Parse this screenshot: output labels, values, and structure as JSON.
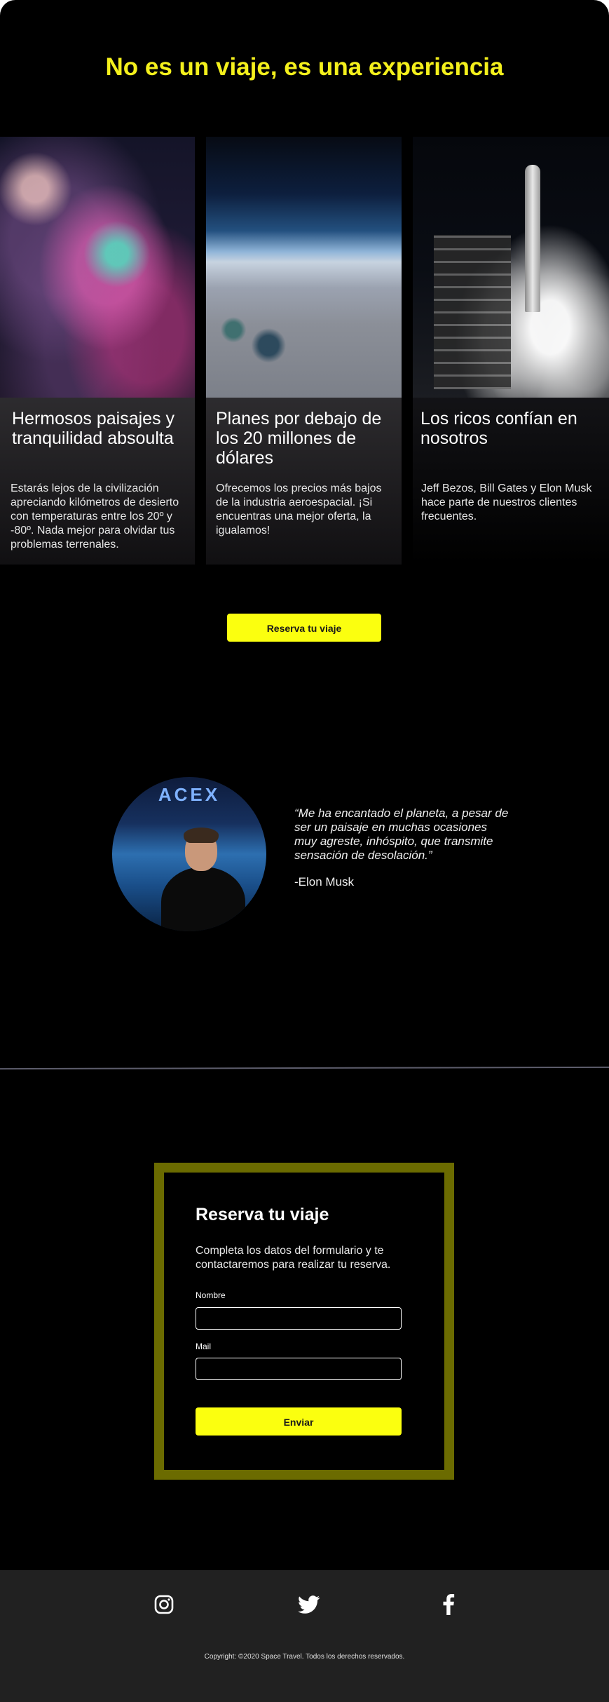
{
  "headline": "No es un viaje, es una experiencia",
  "cards": [
    {
      "title": "Hermosos paisajes y tranquilidad absoulta",
      "text": "Estarás lejos de la civilización apreciando kilómetros de desierto con temperaturas entre los 20º y -80º. Nada mejor para olvidar tus problemas terrenales."
    },
    {
      "title": "Planes por debajo de los 20 millones de dólares",
      "text": "Ofrecemos los precios más bajos de la industria aeroespacial. ¡Si encuentras una mejor oferta, la igualamos!"
    },
    {
      "title": "Los ricos confían en nosotros",
      "text": "Jeff Bezos, Bill Gates y Elon Musk hace parte de nuestros clientes frecuentes."
    }
  ],
  "cta_button": "Reserva tu viaje",
  "testimonial": {
    "image_brand_text": "ACEX",
    "quote": "“Me ha encantado el planeta, a pesar de ser un paisaje en muchas ocasiones muy agreste, inhóspito, que transmite sensación de desolación.”",
    "author": "-Elon Musk"
  },
  "form": {
    "title": "Reserva tu viaje",
    "intro": "Completa los datos del formulario y te contactaremos para realizar tu reserva.",
    "name_label": "Nombre",
    "name_value": "",
    "mail_label": "Mail",
    "mail_value": "",
    "submit_label": "Enviar"
  },
  "footer": {
    "social": [
      "instagram-icon",
      "twitter-icon",
      "facebook-icon"
    ],
    "copyright": "Copyright: ©2020 Space Travel. Todos los derechos reservados."
  },
  "colors": {
    "accent_yellow": "#fbff0f",
    "headline_yellow": "#f4f01c",
    "form_border": "#6b6b00",
    "footer_bg": "#212121",
    "page_bg": "#000000"
  }
}
